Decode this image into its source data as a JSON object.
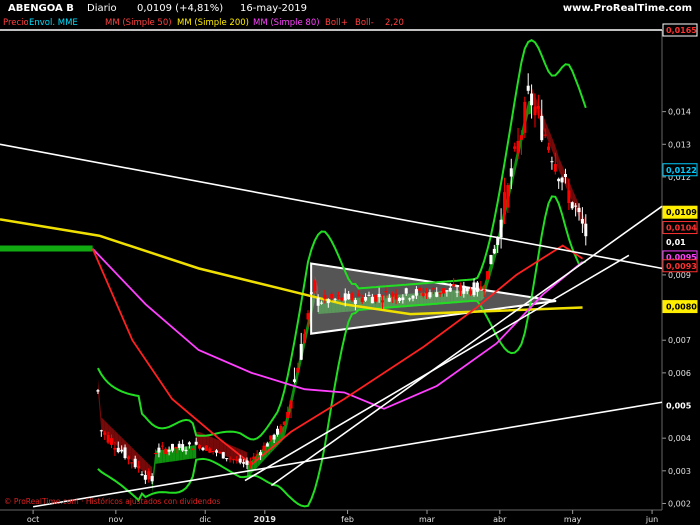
{
  "header": {
    "symbol": "ABENGOA B",
    "period": "Diario",
    "price": "0,0109 (+4,81%)",
    "date": "16-may-2019",
    "site": "www.ProRealTime.com"
  },
  "legend": [
    {
      "label": "Precio",
      "color": "#ff4040",
      "bg": "#000000"
    },
    {
      "label": "Envol. MME",
      "color": "#00e0ff",
      "bg": "#000000"
    },
    {
      "label": "MM (Simple 50)",
      "color": "#ff4040",
      "bg": "#000000"
    },
    {
      "label": "MM (Simple 200)",
      "color": "#ffee00",
      "bg": "#000000"
    },
    {
      "label": "MM (Simple 80)",
      "color": "#ff40ff",
      "bg": "#000000"
    },
    {
      "label": "Boll+",
      "color": "#ff4040",
      "bg": "#000000"
    },
    {
      "label": "Boll-",
      "color": "#ff4040",
      "bg": "#000000"
    },
    {
      "label": "2,20",
      "color": "#ff4040",
      "bg": "#000000"
    }
  ],
  "credit": "© ProRealTime.com · Históricos ajustados con dividendos",
  "colors": {
    "up": "#ffffff",
    "down": "#ff0000",
    "ma50": "#ff2020",
    "ma200": "#f0e000",
    "ma80": "#ff40ff",
    "boll": "#22dd22"
  },
  "chart_data": {
    "type": "candlestick",
    "ylim": [
      0.0018,
      0.0165
    ],
    "x_ticks": [
      "oct",
      "nov",
      "dic",
      "2019",
      "feb",
      "mar",
      "abr",
      "may",
      "jun"
    ],
    "y_ticks": [
      "0,002",
      "0,003",
      "0,004",
      "0,005",
      "0,006",
      "0,007",
      "0,008",
      "0,009",
      "0,01",
      "0,011",
      "0,012",
      "0,013",
      "0,014"
    ],
    "price_tags": [
      {
        "label": "0,0165",
        "value": 0.0165,
        "bg": "#000000",
        "fg": "#ff3030",
        "border": "#ffffff"
      },
      {
        "label": "0,0122",
        "value": 0.01222,
        "bg": "#000000",
        "fg": "#00ccff",
        "border": "#00ccff"
      },
      {
        "label": "0,0109",
        "value": 0.01092,
        "bg": "#ffee00",
        "fg": "#000000",
        "border": "#ffee00"
      },
      {
        "label": "0,0104",
        "value": 0.01045,
        "bg": "#000000",
        "fg": "#ff3030",
        "border": "#ff3030"
      },
      {
        "label": "0,01",
        "value": 0.01,
        "bg": "#000000",
        "fg": "#ffffff",
        "border": "#000000"
      },
      {
        "label": "0,0095",
        "value": 0.00955,
        "bg": "#000000",
        "fg": "#ff40ff",
        "border": "#ff40ff"
      },
      {
        "label": "0,0093",
        "value": 0.00928,
        "bg": "#000000",
        "fg": "#ff3030",
        "border": "#ff3030"
      },
      {
        "label": "0,0080",
        "value": 0.00803,
        "bg": "#ffee00",
        "fg": "#000000",
        "border": "#ffee00"
      },
      {
        "label": "0,005",
        "value": 0.005,
        "bg": "#000000",
        "fg": "#ffffff",
        "border": "#000000"
      }
    ],
    "trend_lines": [
      {
        "from": [
          0.0,
          0.013
        ],
        "to": [
          1.0,
          0.0092
        ]
      },
      {
        "from": [
          0.37,
          0.0027
        ],
        "to": [
          0.95,
          0.0096
        ]
      },
      {
        "from": [
          0.41,
          0.00255
        ],
        "to": [
          1.0,
          0.0111
        ]
      },
      {
        "from": [
          0.05,
          0.0019
        ],
        "to": [
          1.0,
          0.0051
        ]
      },
      {
        "from": [
          0.0,
          0.0165
        ],
        "to": [
          1.0,
          0.0165
        ]
      }
    ],
    "triangle": [
      [
        0.47,
        0.00935
      ],
      [
        0.84,
        0.0082
      ],
      [
        0.47,
        0.0072
      ]
    ],
    "segments": [
      {
        "t0": 0.0,
        "t1": 0.14,
        "p0": 0.0098,
        "p1": 0.0098,
        "vol": 2e-05
      },
      {
        "t0": 0.14,
        "t1": 0.15,
        "p0": 0.0098,
        "p1": 0.0043,
        "vol": 0.0003
      },
      {
        "t0": 0.15,
        "t1": 0.23,
        "p0": 0.0043,
        "p1": 0.0027,
        "vol": 0.0002
      },
      {
        "t0": 0.23,
        "t1": 0.3,
        "p0": 0.0036,
        "p1": 0.0038,
        "vol": 0.00015
      },
      {
        "t0": 0.3,
        "t1": 0.37,
        "p0": 0.0038,
        "p1": 0.0032,
        "vol": 0.00012
      },
      {
        "t0": 0.37,
        "t1": 0.43,
        "p0": 0.0031,
        "p1": 0.0044,
        "vol": 0.00015
      },
      {
        "t0": 0.43,
        "t1": 0.48,
        "p0": 0.0044,
        "p1": 0.009,
        "vol": 0.0004
      },
      {
        "t0": 0.48,
        "t1": 0.73,
        "p0": 0.0082,
        "p1": 0.0086,
        "vol": 0.0002
      },
      {
        "t0": 0.73,
        "t1": 0.75,
        "p0": 0.0086,
        "p1": 0.01,
        "vol": 0.0002
      },
      {
        "t0": 0.75,
        "t1": 0.8,
        "p0": 0.01,
        "p1": 0.0145,
        "vol": 0.0005
      },
      {
        "t0": 0.8,
        "t1": 0.84,
        "p0": 0.0145,
        "p1": 0.0125,
        "vol": 0.0005
      },
      {
        "t0": 0.84,
        "t1": 0.88,
        "p0": 0.0124,
        "p1": 0.0105,
        "vol": 0.0004
      }
    ],
    "ma200": [
      [
        0.0,
        0.0107
      ],
      [
        0.15,
        0.0102
      ],
      [
        0.3,
        0.0092
      ],
      [
        0.42,
        0.0086
      ],
      [
        0.52,
        0.0081
      ],
      [
        0.62,
        0.0078
      ],
      [
        0.75,
        0.0079
      ],
      [
        0.88,
        0.008
      ]
    ],
    "ma80": [
      [
        0.14,
        0.0098
      ],
      [
        0.22,
        0.0081
      ],
      [
        0.3,
        0.0067
      ],
      [
        0.38,
        0.006
      ],
      [
        0.46,
        0.0055
      ],
      [
        0.52,
        0.0054
      ],
      [
        0.58,
        0.0049
      ],
      [
        0.66,
        0.0056
      ],
      [
        0.75,
        0.0069
      ],
      [
        0.82,
        0.0084
      ],
      [
        0.88,
        0.0094
      ]
    ],
    "ma50": [
      [
        0.14,
        0.0098
      ],
      [
        0.2,
        0.007
      ],
      [
        0.26,
        0.0052
      ],
      [
        0.33,
        0.004
      ],
      [
        0.38,
        0.0032
      ],
      [
        0.44,
        0.0042
      ],
      [
        0.52,
        0.0052
      ],
      [
        0.58,
        0.006
      ],
      [
        0.64,
        0.0068
      ],
      [
        0.72,
        0.008
      ],
      [
        0.78,
        0.009
      ],
      [
        0.85,
        0.0099
      ],
      [
        0.88,
        0.0095
      ]
    ]
  }
}
